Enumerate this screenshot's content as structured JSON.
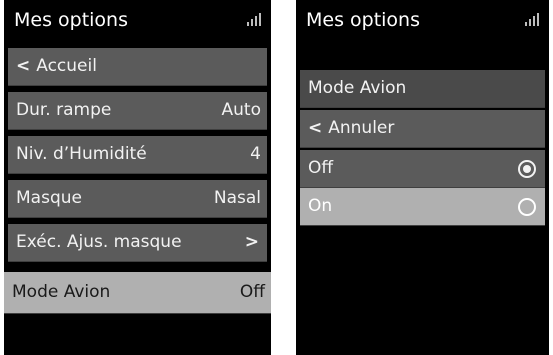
{
  "left_screen": {
    "title": "Mes options",
    "items": [
      {
        "label": "Accueil",
        "icon": "chevron-left-icon"
      },
      {
        "label": "Dur. rampe",
        "value": "Auto"
      },
      {
        "label": "Niv. d’Humidité",
        "value": "4"
      },
      {
        "label": "Masque",
        "value": "Nasal"
      },
      {
        "label": "Exéc. Ajus. masque",
        "icon": "chevron-right-icon"
      },
      {
        "label": "Mode Avion",
        "value": "Off",
        "selected": true
      }
    ]
  },
  "right_screen": {
    "title": "Mes options",
    "section_title": "Mode Avion",
    "cancel_label": "Annuler",
    "options": [
      {
        "label": "Off",
        "checked": true
      },
      {
        "label": "On",
        "checked": false,
        "highlighted": true
      }
    ]
  },
  "colors": {
    "row_bg": "#5b5b5b",
    "selected_bg": "#b0b0b0",
    "screen_bg": "#000000"
  }
}
